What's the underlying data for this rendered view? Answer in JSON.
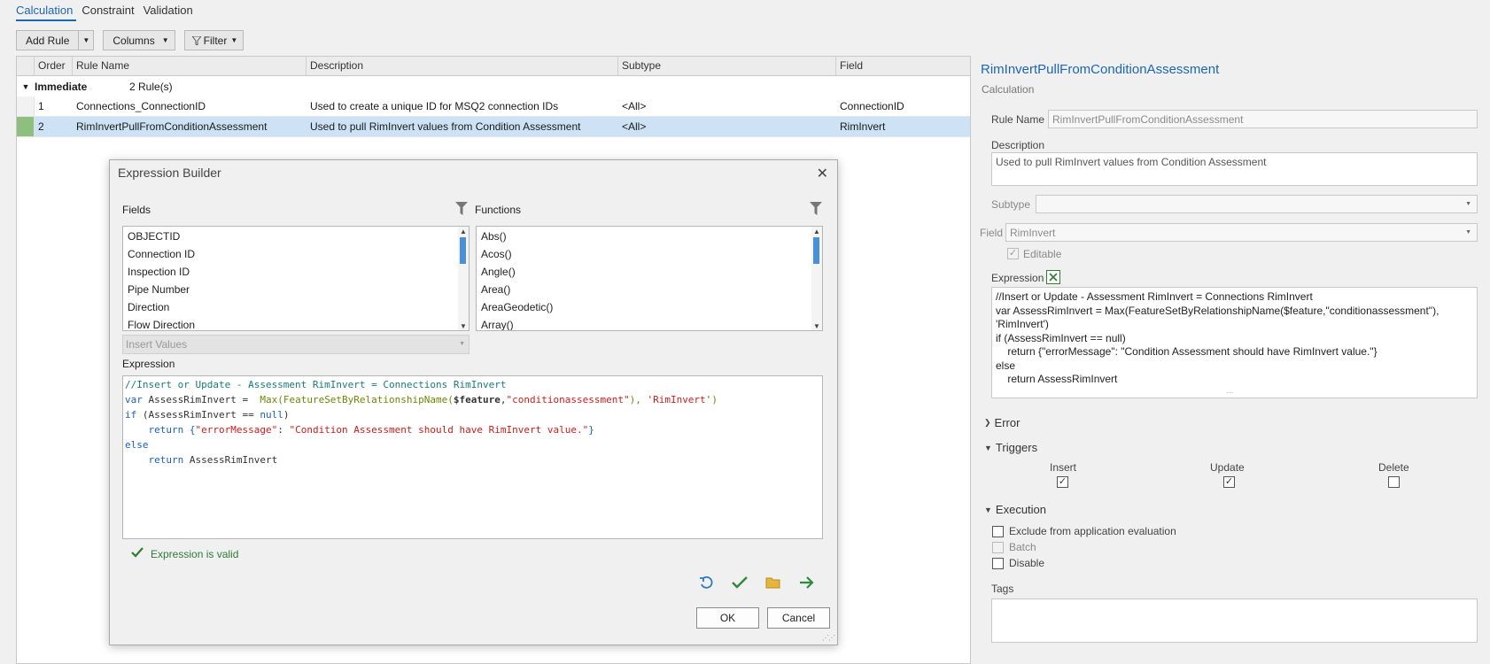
{
  "tabs": [
    {
      "label": "Calculation",
      "active": true
    },
    {
      "label": "Constraint",
      "active": false
    },
    {
      "label": "Validation",
      "active": false
    }
  ],
  "toolbar": {
    "add_rule": "Add Rule",
    "columns": "Columns",
    "filter": "Filter"
  },
  "grid": {
    "headers": [
      "Order",
      "Rule Name",
      "Description",
      "Subtype",
      "Field"
    ],
    "group_name": "Immediate",
    "group_count": "2 Rule(s)",
    "rows": [
      {
        "order": "1",
        "name": "Connections_ConnectionID",
        "description": "Used to create a unique ID for MSQ2 connection IDs",
        "subtype": "<All>",
        "field": "ConnectionID"
      },
      {
        "order": "2",
        "name": "RimInvertPullFromConditionAssessment",
        "description": "Used to pull RimInvert values from Condition Assessment",
        "subtype": "<All>",
        "field": "RimInvert"
      }
    ]
  },
  "panel": {
    "title": "RimInvertPullFromConditionAssessment",
    "subtitle": "Calculation",
    "rule_name_label": "Rule Name",
    "rule_name_value": "RimInvertPullFromConditionAssessment",
    "description_label": "Description",
    "description_value": "Used to pull RimInvert values from Condition Assessment",
    "subtype_label": "Subtype",
    "subtype_value": "",
    "field_label": "Field",
    "field_value": "RimInvert",
    "editable_label": "Editable",
    "expression_label": "Expression",
    "expression_lines": [
      "//Insert or Update - Assessment RimInvert = Connections RimInvert",
      "var AssessRimInvert =  Max(FeatureSetByRelationshipName($feature,\"conditionassessment\"),",
      "'RimInvert')",
      "if (AssessRimInvert == null)",
      "    return {\"errorMessage\": \"Condition Assessment should have RimInvert value.\"}",
      "else",
      "    return AssessRimInvert"
    ],
    "error_label": "Error",
    "triggers_label": "Triggers",
    "trigger_insert": "Insert",
    "trigger_update": "Update",
    "trigger_delete": "Delete",
    "execution_label": "Execution",
    "exclude_label": "Exclude from application evaluation",
    "batch_label": "Batch",
    "disable_label": "Disable",
    "tags_label": "Tags"
  },
  "dialog": {
    "title": "Expression Builder",
    "fields_label": "Fields",
    "functions_label": "Functions",
    "fields": [
      "OBJECTID",
      "Connection ID",
      "Inspection ID",
      "Pipe Number",
      "Direction",
      "Flow Direction"
    ],
    "functions": [
      "Abs()",
      "Acos()",
      "Angle()",
      "Area()",
      "AreaGeodetic()",
      "Array()"
    ],
    "insert_values": "Insert Values",
    "expression_label": "Expression",
    "code": {
      "l1": "//Insert or Update - Assessment RimInvert = Connections RimInvert",
      "l2_var": "var",
      "l2_name": " AssessRimInvert = ",
      "l2_fn": " Max(FeatureSetByRelationshipName(",
      "l2_feature": "$feature",
      "l2_comma": ",",
      "l2_str1": "\"conditionassessment\"",
      "l2_mid": "), ",
      "l2_str2": "'RimInvert'",
      "l2_end": ")",
      "l3_if": "if",
      "l3_rest": " (AssessRimInvert == ",
      "l3_null": "null",
      "l3_end": ")",
      "l4_return": "    return",
      "l4_b1": " {",
      "l4_key": "\"errorMessage\"",
      "l4_colon": ": ",
      "l4_val": "\"Condition Assessment should have RimInvert value.\"",
      "l4_b2": "}",
      "l5_else": "else",
      "l6_return": "    return",
      "l6_rest": " AssessRimInvert"
    },
    "valid_text": "Expression is valid",
    "ok": "OK",
    "cancel": "Cancel"
  },
  "colors": {
    "accent": "#1b66b5",
    "selected_row": "#cde2f4",
    "valid_green": "#2e7d32"
  }
}
